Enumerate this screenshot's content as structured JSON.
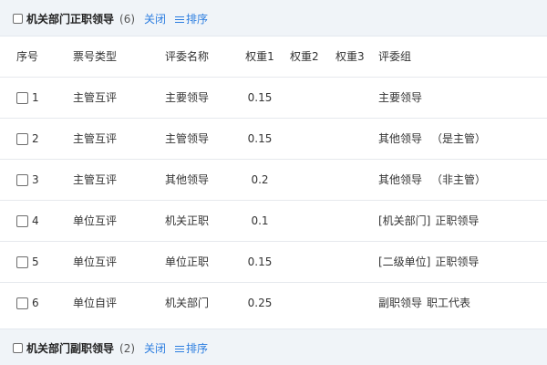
{
  "group1": {
    "title": "机关部门正职领导",
    "count": "(6)",
    "close_label": "关闭",
    "sort_label": "排序"
  },
  "columns": [
    "序号",
    "票号类型",
    "评委名称",
    "权重1",
    "权重2",
    "权重3",
    "评委组"
  ],
  "rows": [
    {
      "seq": "1",
      "type": "主管互评",
      "name": "主要领导",
      "w1": "0.15",
      "w2": "",
      "w3": "",
      "group_a": "主要领导",
      "group_b": ""
    },
    {
      "seq": "2",
      "type": "主管互评",
      "name": "主管领导",
      "w1": "0.15",
      "w2": "",
      "w3": "",
      "group_a": "其他领导",
      "group_b": "（是主管）"
    },
    {
      "seq": "3",
      "type": "主管互评",
      "name": "其他领导",
      "w1": "0.2",
      "w2": "",
      "w3": "",
      "group_a": "其他领导",
      "group_b": "（非主管）"
    },
    {
      "seq": "4",
      "type": "单位互评",
      "name": "机关正职",
      "w1": "0.1",
      "w2": "",
      "w3": "",
      "group_a": "[机关部门]",
      "group_b": "正职领导"
    },
    {
      "seq": "5",
      "type": "单位互评",
      "name": "单位正职",
      "w1": "0.15",
      "w2": "",
      "w3": "",
      "group_a": "[二级单位]",
      "group_b": "正职领导"
    },
    {
      "seq": "6",
      "type": "单位自评",
      "name": "机关部门",
      "w1": "0.25",
      "w2": "",
      "w3": "",
      "group_a": "副职领导",
      "group_b": "职工代表"
    }
  ],
  "group2": {
    "title": "机关部门副职领导",
    "count": "(2)",
    "close_label": "关闭",
    "sort_label": "排序"
  },
  "colors": {
    "header_bg": "#f0f4f8",
    "link": "#2d7ee0",
    "border": "#e6e9ed"
  }
}
